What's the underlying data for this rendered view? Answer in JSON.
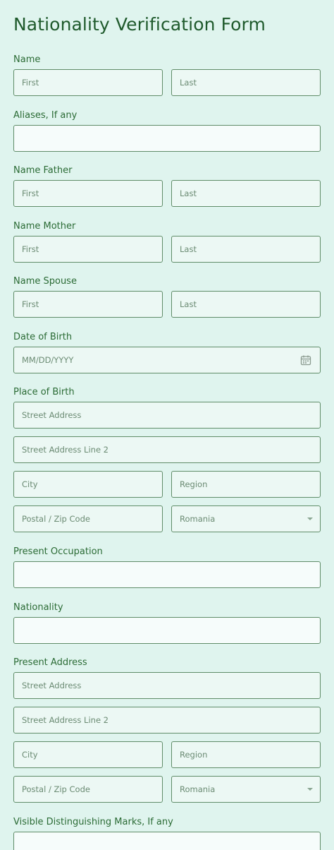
{
  "form": {
    "title": "Nationality Verification Form"
  },
  "name": {
    "label": "Name",
    "first_placeholder": "First",
    "last_placeholder": "Last"
  },
  "aliases": {
    "label": "Aliases, If any",
    "value": ""
  },
  "father": {
    "label": "Name Father",
    "first_placeholder": "First",
    "last_placeholder": "Last"
  },
  "mother": {
    "label": "Name Mother",
    "first_placeholder": "First",
    "last_placeholder": "Last"
  },
  "spouse": {
    "label": "Name Spouse",
    "first_placeholder": "First",
    "last_placeholder": "Last"
  },
  "dob": {
    "label": "Date of Birth",
    "placeholder": "MM/DD/YYYY",
    "icon": "calendar-icon"
  },
  "birth_place": {
    "label": "Place of Birth",
    "street_placeholder": "Street Address",
    "street2_placeholder": "Street Address Line 2",
    "city_placeholder": "City",
    "region_placeholder": "Region",
    "postal_placeholder": "Postal / Zip Code",
    "country_value": "Romania"
  },
  "occupation": {
    "label": "Present Occupation",
    "value": ""
  },
  "nationality": {
    "label": "Nationality",
    "value": ""
  },
  "present_address": {
    "label": "Present Address",
    "street_placeholder": "Street Address",
    "street2_placeholder": "Street Address Line 2",
    "city_placeholder": "City",
    "region_placeholder": "Region",
    "postal_placeholder": "Postal / Zip Code",
    "country_value": "Romania"
  },
  "marks": {
    "label": "Visible Distinguishing Marks, If any",
    "value": ""
  },
  "colors": {
    "background": "#dff4ee",
    "accent": "#1f5a2c",
    "field_fill": "#ecf8f4",
    "field_border": "#5f8c68"
  }
}
